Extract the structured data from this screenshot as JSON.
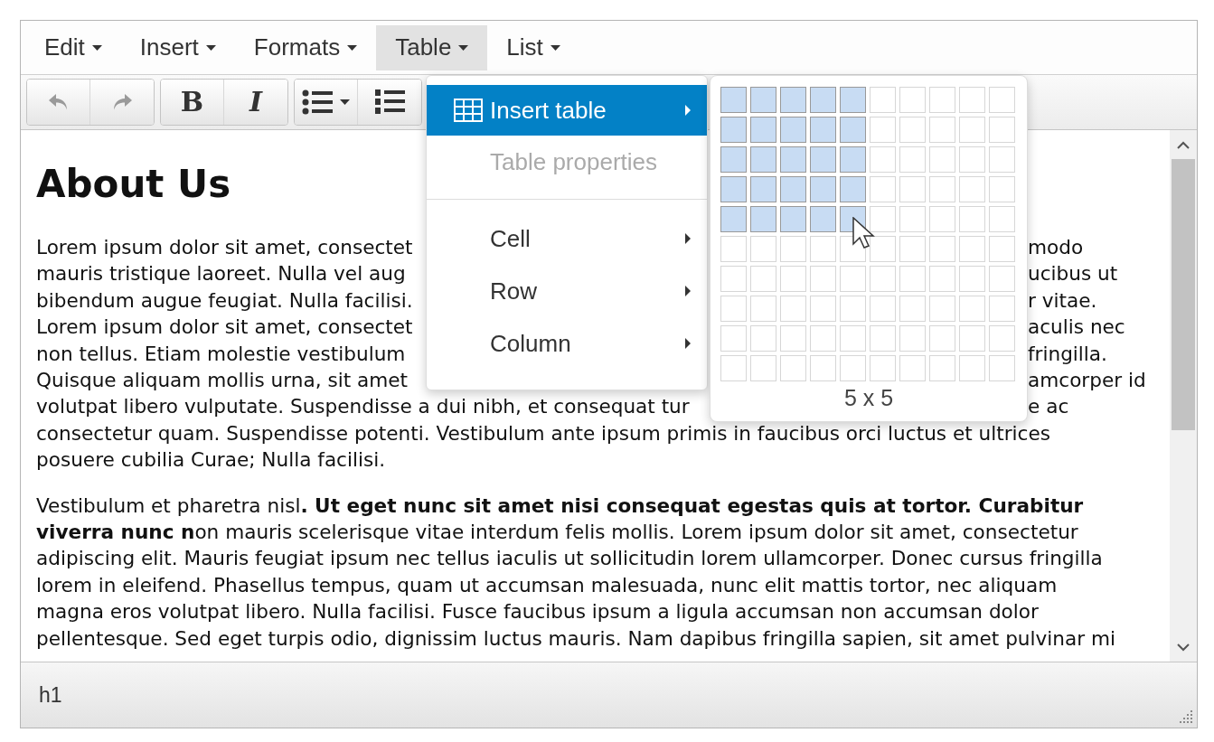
{
  "menubar": [
    {
      "label": "Edit",
      "selected": false
    },
    {
      "label": "Insert",
      "selected": false
    },
    {
      "label": "Formats",
      "selected": false
    },
    {
      "label": "Table",
      "selected": true
    },
    {
      "label": "List",
      "selected": false
    }
  ],
  "toolbar": [
    {
      "buttons": [
        {
          "kind": "undo",
          "disabled": true
        },
        {
          "kind": "redo",
          "disabled": true
        }
      ]
    },
    {
      "buttons": [
        {
          "kind": "bold",
          "label": "B",
          "disabled": false
        },
        {
          "kind": "italic",
          "label": "I",
          "disabled": false
        }
      ]
    },
    {
      "buttons": [
        {
          "kind": "bullet-list",
          "disabled": false
        },
        {
          "kind": "numbered-list",
          "disabled": false
        }
      ]
    }
  ],
  "editor": {
    "heading": "About Us",
    "paragraph_1_lines": [
      {
        "left": "Lorem ipsum dolor sit amet, consectet",
        "right": "modo"
      },
      {
        "left": "mauris tristique laoreet. Nulla vel aug",
        "right": "ucibus ut"
      },
      {
        "left": "bibendum augue feugiat. Nulla facilisi.",
        "right": "r vitae."
      },
      {
        "left": "Lorem ipsum dolor sit amet, consectet",
        "right": "aculis nec"
      },
      {
        "left": "non tellus. Etiam molestie vestibulum",
        "right": "fringilla."
      },
      {
        "left": "Quisque aliquam mollis urna, sit amet",
        "right": "amcorper id"
      },
      {
        "left": "volutpat libero vulputate. Suspendisse a dui nibh, et consequat tur",
        "right": "e ac"
      },
      {
        "left": "consectetur quam. Suspendisse potenti. Vestibulum ante ipsum primis in faucibus orci luctus et ultrices"
      },
      {
        "left": "posuere cubilia Curae; Nulla facilisi."
      }
    ],
    "paragraph_2_lines": [
      "Vestibulum et pharetra nisl**. Ut eget nunc sit amet nisi consequat egestas quis at tortor. Curabitur**",
      "**viverra nunc n**on mauris scelerisque vitae interdum felis mollis. Lorem ipsum dolor sit amet, consectetur",
      "adipiscing elit. Mauris feugiat ipsum nec tellus iaculis ut sollicitudin lorem ullamcorper. Donec cursus fringilla",
      "lorem in eleifend. Phasellus tempus, quam ut accumsan malesuada, nunc elit mattis tortor, nec aliquam",
      "magna eros volutpat libero. Nulla facilisi. Fusce faucibus ipsum a ligula accumsan non accumsan dolor",
      "pellentesque. Sed eget turpis odio, dignissim luctus mauris. Nam dapibus fringilla sapien, sit amet pulvinar mi"
    ]
  },
  "table_menu": {
    "items": [
      {
        "kind": "icon-item",
        "label": "Insert table",
        "selected": true,
        "disabled": false,
        "submenu": true
      },
      {
        "kind": "item",
        "label": "Table properties",
        "selected": false,
        "disabled": true,
        "submenu": false
      },
      {
        "kind": "separator"
      },
      {
        "kind": "item",
        "label": "Cell",
        "selected": false,
        "disabled": false,
        "submenu": true
      },
      {
        "kind": "item",
        "label": "Row",
        "selected": false,
        "disabled": false,
        "submenu": true
      },
      {
        "kind": "item",
        "label": "Column",
        "selected": false,
        "disabled": false,
        "submenu": true
      }
    ]
  },
  "grid_picker": {
    "rows": [
      {
        "selected": [
          true,
          true,
          true,
          true,
          true,
          false,
          false,
          false,
          false,
          false
        ]
      },
      {
        "selected": [
          true,
          true,
          true,
          true,
          true,
          false,
          false,
          false,
          false,
          false
        ]
      },
      {
        "selected": [
          true,
          true,
          true,
          true,
          true,
          false,
          false,
          false,
          false,
          false
        ]
      },
      {
        "selected": [
          true,
          true,
          true,
          true,
          true,
          false,
          false,
          false,
          false,
          false
        ]
      },
      {
        "selected": [
          true,
          true,
          true,
          true,
          true,
          false,
          false,
          false,
          false,
          false
        ]
      },
      {
        "selected": [
          false,
          false,
          false,
          false,
          false,
          false,
          false,
          false,
          false,
          false
        ]
      },
      {
        "selected": [
          false,
          false,
          false,
          false,
          false,
          false,
          false,
          false,
          false,
          false
        ]
      },
      {
        "selected": [
          false,
          false,
          false,
          false,
          false,
          false,
          false,
          false,
          false,
          false
        ]
      },
      {
        "selected": [
          false,
          false,
          false,
          false,
          false,
          false,
          false,
          false,
          false,
          false
        ]
      },
      {
        "selected": [
          false,
          false,
          false,
          false,
          false,
          false,
          false,
          false,
          false,
          false
        ]
      }
    ],
    "caption": "5 x 5"
  },
  "status_bar": {
    "path": "h1"
  }
}
